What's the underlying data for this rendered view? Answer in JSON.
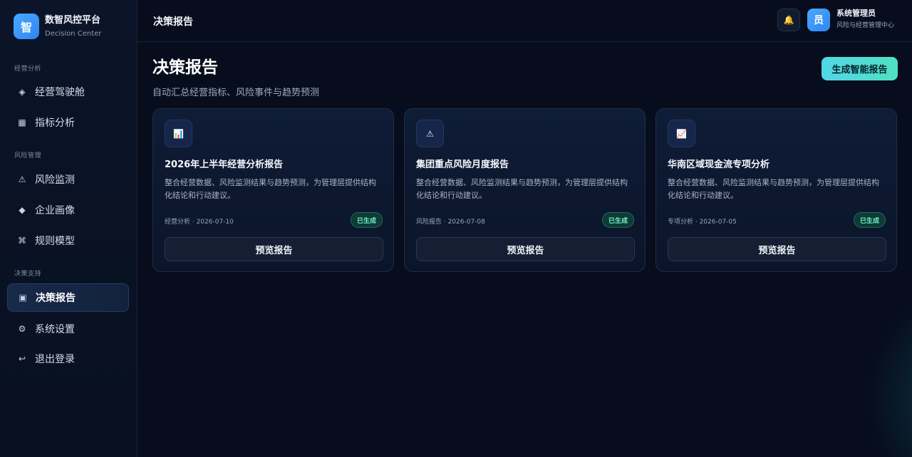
{
  "brand": {
    "logo_char": "智",
    "name": "数智风控平台",
    "subtitle": "Decision Center"
  },
  "sidebar": {
    "sections": [
      {
        "label": "经营分析"
      },
      {
        "label": "风险管理"
      },
      {
        "label": "决策支持"
      }
    ],
    "items": [
      {
        "icon": "◈",
        "label": "经营驾驶舱"
      },
      {
        "icon": "▦",
        "label": "指标分析"
      },
      {
        "icon": "⚠",
        "label": "风险监测"
      },
      {
        "icon": "◆",
        "label": "企业画像"
      },
      {
        "icon": "⌘",
        "label": "规则模型"
      },
      {
        "icon": "▣",
        "label": "决策报告",
        "active": true
      },
      {
        "icon": "⚙",
        "label": "系统设置"
      },
      {
        "icon": "↩",
        "label": "退出登录"
      }
    ]
  },
  "header": {
    "title": "决策报告",
    "bell_icon": "🔔",
    "user": {
      "avatar_char": "员",
      "name": "系统管理员",
      "dept": "风险与经营管理中心"
    }
  },
  "page": {
    "title": "决策报告",
    "subtitle": "自动汇总经营指标、风险事件与趋势预测",
    "generate_button": "生成智能报告"
  },
  "cards": [
    {
      "icon": "📊",
      "title": "2026年上半年经营分析报告",
      "desc": "整合经营数据、风险监测结果与趋势预测，为管理层提供结构化结论和行动建议。",
      "meta": "经营分析 · 2026-07-10",
      "badge": "已生成",
      "button": "预览报告"
    },
    {
      "icon": "⚠",
      "title": "集团重点风险月度报告",
      "desc": "整合经营数据、风险监测结果与趋势预测，为管理层提供结构化结论和行动建议。",
      "meta": "风险报告 · 2026-07-08",
      "badge": "已生成",
      "button": "预览报告"
    },
    {
      "icon": "📈",
      "title": "华南区域现金流专项分析",
      "desc": "整合经营数据、风险监测结果与趋势预测，为管理层提供结构化结论和行动建议。",
      "meta": "专项分析 · 2026-07-05",
      "badge": "已生成",
      "button": "预览报告"
    }
  ],
  "colors": {
    "accent": "#4fd8d6",
    "primary": "#3b96f5",
    "success": "#6ff0c7",
    "background": "#070d1c"
  }
}
